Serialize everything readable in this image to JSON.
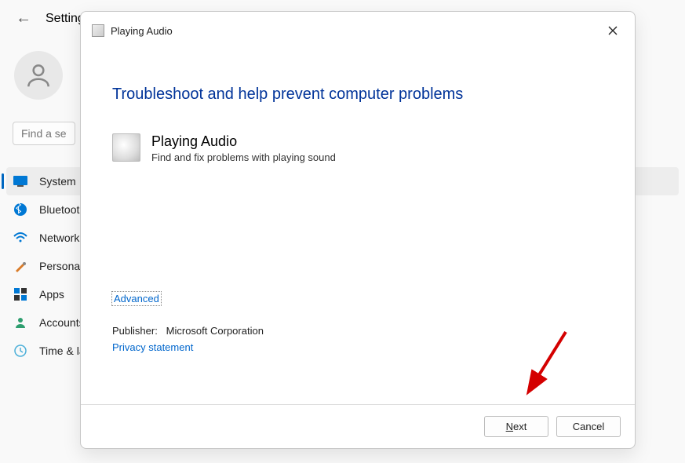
{
  "settings": {
    "title": "Settings",
    "search_placeholder": "Find a setting",
    "nav": [
      {
        "label": "System"
      },
      {
        "label": "Bluetooth & devices"
      },
      {
        "label": "Network & internet"
      },
      {
        "label": "Personalization"
      },
      {
        "label": "Apps"
      },
      {
        "label": "Accounts"
      },
      {
        "label": "Time & language"
      }
    ]
  },
  "dialog": {
    "window_title": "Playing Audio",
    "heading": "Troubleshoot and help prevent computer problems",
    "item_title": "Playing Audio",
    "item_desc": "Find and fix problems with playing sound",
    "advanced_label": "Advanced",
    "publisher_label": "Publisher:",
    "publisher_value": "Microsoft Corporation",
    "privacy_label": "Privacy statement",
    "next_label": "Next",
    "cancel_label": "Cancel"
  }
}
